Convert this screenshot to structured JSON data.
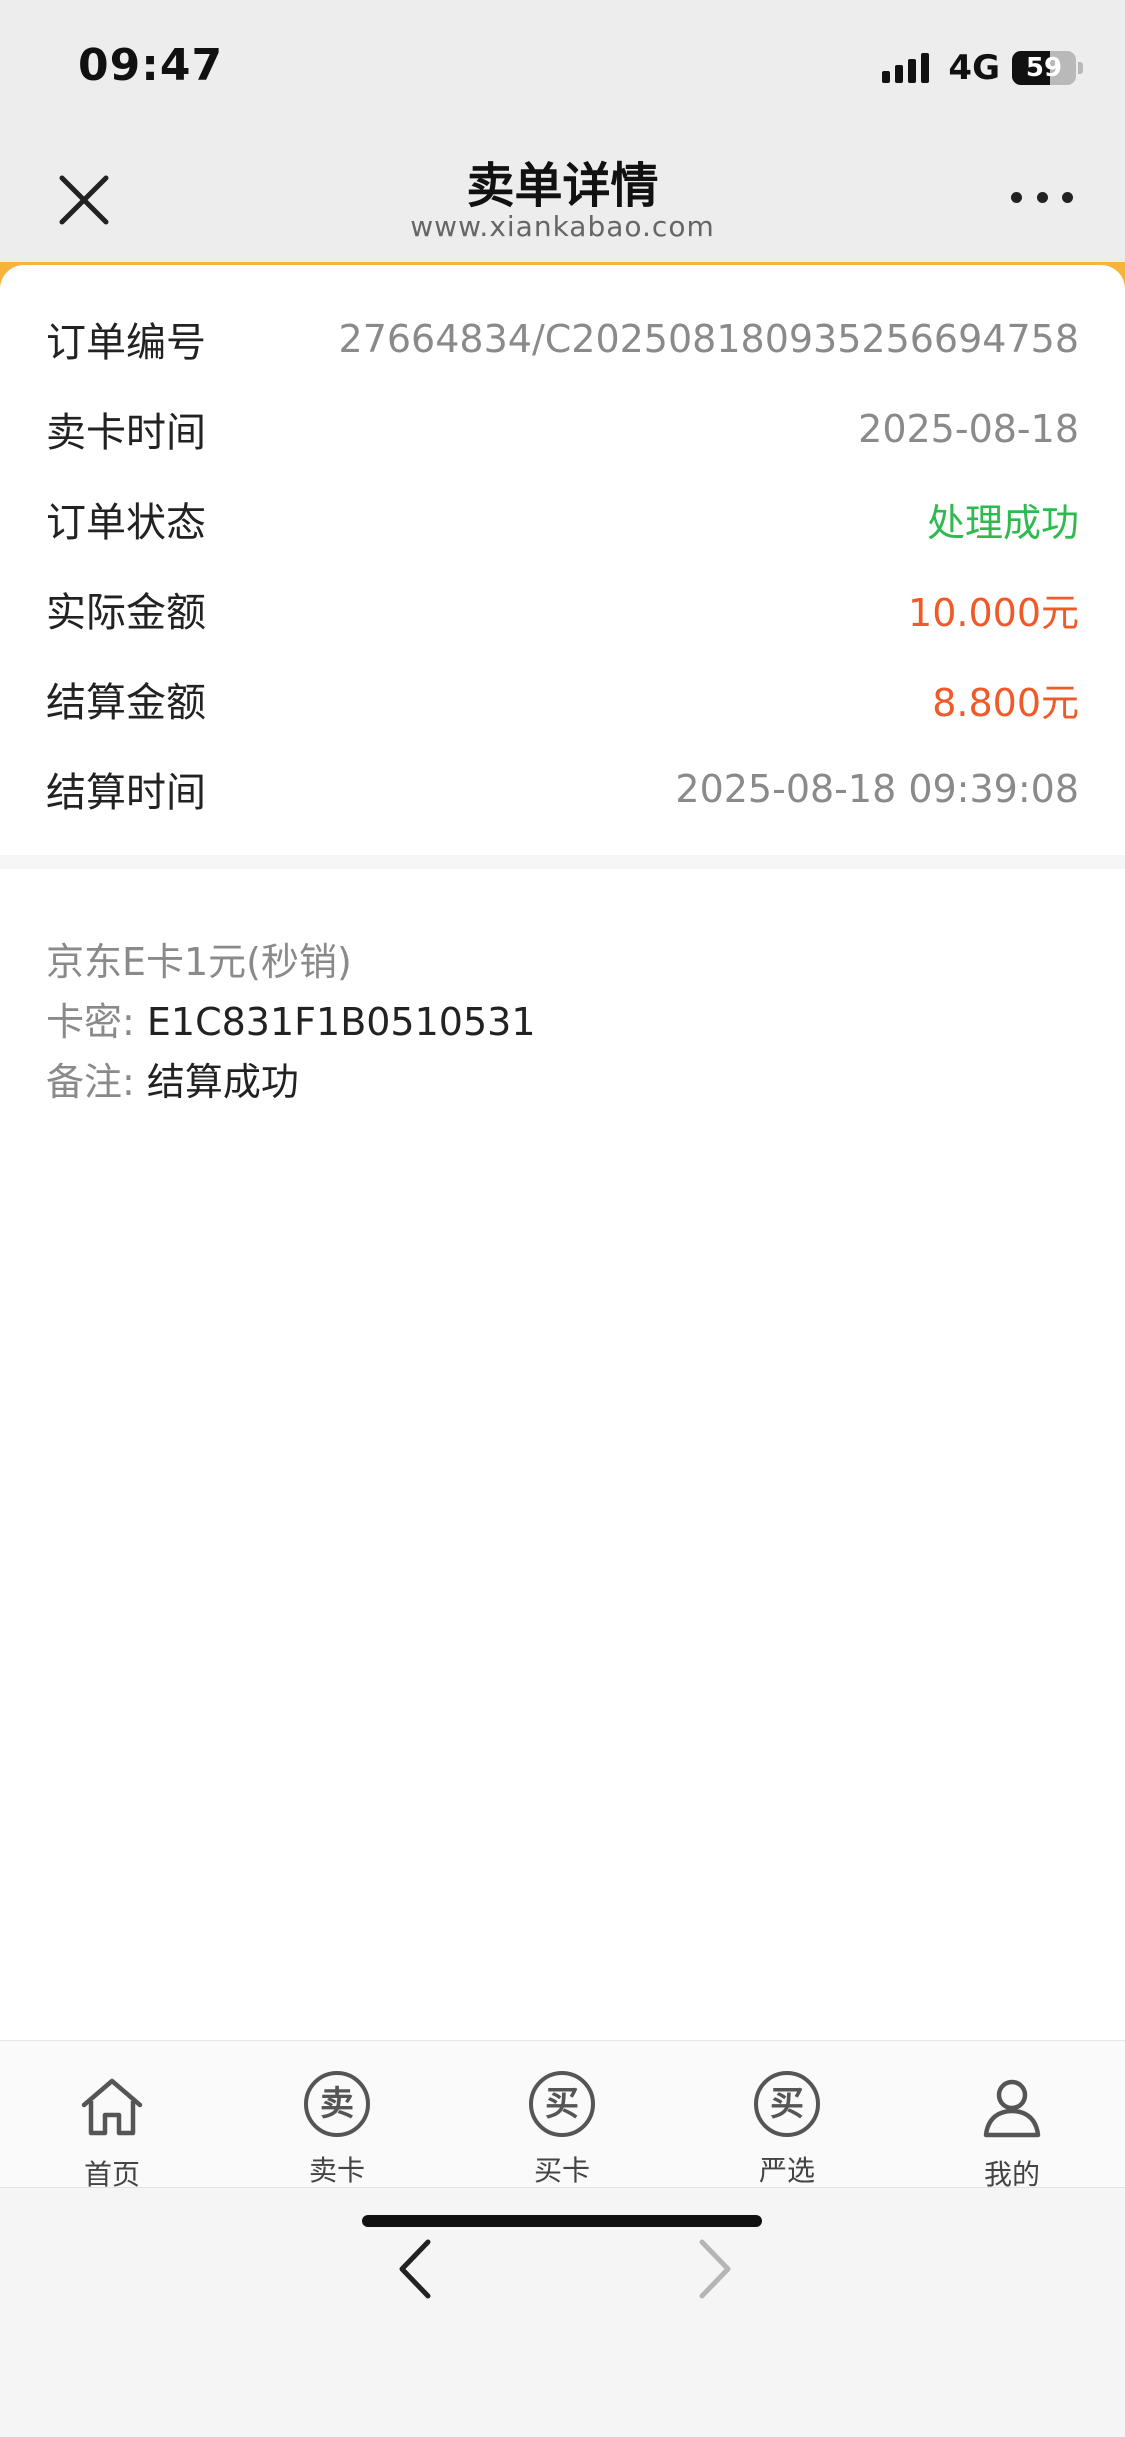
{
  "status_bar": {
    "time": "09:47",
    "network": "4G",
    "battery": "59",
    "battery_level_percent": 59
  },
  "header": {
    "title": "卖单详情",
    "subtitle": "www.xiankabao.com"
  },
  "order": {
    "rows": [
      {
        "label": "订单编号",
        "value": "27664834/C202508180935256694758",
        "tone": "gray"
      },
      {
        "label": "卖卡时间",
        "value": "2025-08-18",
        "tone": "gray"
      },
      {
        "label": "订单状态",
        "value": "处理成功",
        "tone": "green"
      },
      {
        "label": "实际金额",
        "value": "10.000元",
        "tone": "red"
      },
      {
        "label": "结算金额",
        "value": "8.800元",
        "tone": "red"
      },
      {
        "label": "结算时间",
        "value": "2025-08-18 09:39:08",
        "tone": "gray"
      }
    ]
  },
  "card_info": {
    "product": "京东E卡1元(秒销)",
    "secret_label": "卡密:",
    "secret_value": "E1C831F1B0510531",
    "note_label": "备注:",
    "note_value": "结算成功"
  },
  "tabbar": {
    "items": [
      {
        "label": "首页",
        "icon": "home-icon"
      },
      {
        "label": "卖卡",
        "icon": "sell-card-icon",
        "glyph": "卖"
      },
      {
        "label": "买卡",
        "icon": "buy-card-icon",
        "glyph": "买"
      },
      {
        "label": "严选",
        "icon": "select-icon",
        "glyph": "买"
      },
      {
        "label": "我的",
        "icon": "profile-icon"
      }
    ]
  },
  "colors": {
    "accent": "#f7b43d",
    "success": "#2dba4e",
    "amount": "#f05a28",
    "muted": "#8a8a8a"
  }
}
